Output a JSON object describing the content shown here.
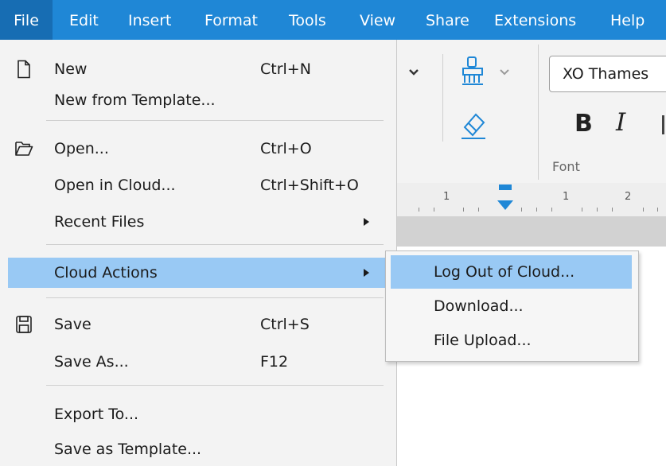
{
  "menubar": {
    "items": [
      {
        "label": "File",
        "active": true
      },
      {
        "label": "Edit"
      },
      {
        "label": "Insert"
      },
      {
        "label": "Format"
      },
      {
        "label": "Tools"
      },
      {
        "label": "View"
      },
      {
        "label": "Share"
      },
      {
        "label": "Extensions"
      },
      {
        "label": "Help"
      }
    ]
  },
  "toolbar": {
    "font_name": "XO Thames",
    "bold_label": "B",
    "italic_label": "I",
    "font_group_label": "Font",
    "icons": [
      "format-painter-icon",
      "eraser-icon"
    ]
  },
  "ruler": {
    "numbers": [
      "1",
      "1",
      "2"
    ]
  },
  "file_menu": {
    "items": [
      {
        "label": "New",
        "shortcut": "Ctrl+N",
        "icon": "new-document-icon"
      },
      {
        "label": "New from Template..."
      },
      {
        "label": "Open...",
        "shortcut": "Ctrl+O",
        "icon": "folder-open-icon"
      },
      {
        "label": "Open in Cloud...",
        "shortcut": "Ctrl+Shift+O"
      },
      {
        "label": "Recent Files",
        "submenu": true
      },
      {
        "label": "Cloud Actions",
        "submenu": true,
        "highlighted": true
      },
      {
        "label": "Save",
        "shortcut": "Ctrl+S",
        "icon": "save-icon"
      },
      {
        "label": "Save As...",
        "shortcut": "F12"
      },
      {
        "label": "Export To..."
      },
      {
        "label": "Save as Template..."
      }
    ]
  },
  "cloud_submenu": {
    "items": [
      {
        "label": "Log Out of Cloud...",
        "highlighted": true
      },
      {
        "label": "Download..."
      },
      {
        "label": "File Upload..."
      }
    ]
  },
  "colors": {
    "menubar_bg": "#1f87d6",
    "menubar_active": "#176db3",
    "highlight": "#99c9f4",
    "menu_bg": "#f3f3f3",
    "ruler_marker": "#1f87d6"
  }
}
